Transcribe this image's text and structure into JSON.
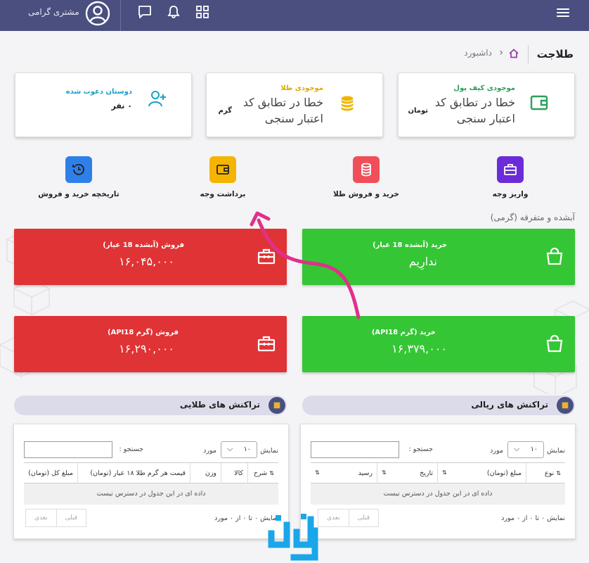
{
  "topbar": {
    "user_name": "مشتری گرامی",
    "icons": [
      "menu-icon",
      "grid-icon",
      "bell-icon",
      "chat-icon",
      "user-avatar-icon"
    ]
  },
  "breadcrumb": {
    "brand": "طلاجت",
    "current": "داشبورد"
  },
  "cards": {
    "wallet": {
      "title": "موجودی کیف پول",
      "value": "خطا در تطابق کد اعتبار سنجی",
      "unit": "تومان",
      "color": "#2e9e59"
    },
    "gold": {
      "title": "موجودی طلا",
      "value": "خطا در تطابق کد اعتبار سنجی",
      "unit": "گرم",
      "color": "#e0a800"
    },
    "friends": {
      "title": "دوستان دعوت شده",
      "value": "۰ نفر",
      "color": "#17a2c7"
    }
  },
  "actions": [
    {
      "label": "واریز وجه",
      "color": "#6b2bd9"
    },
    {
      "label": "خرید و فروش طلا",
      "color": "#f04e58"
    },
    {
      "label": "برداشت وجه",
      "color": "#f5b400"
    },
    {
      "label": "تاریخچه خرید و فروش",
      "color": "#2f7fe8"
    }
  ],
  "section_label": "آبشده و متفرقه (گرمی)",
  "tiles": {
    "buy_melted": {
      "title": "خرید (آبشده 18 عیار)",
      "value": "ندارِیم"
    },
    "sell_melted": {
      "title": "فروش (آبشده 18 عیار)",
      "value": "۱۶,۰۴۵,۰۰۰"
    },
    "buy_api": {
      "title": "خرید (گرم API18)",
      "value": "۱۶,۳۷۹,۰۰۰"
    },
    "sell_api": {
      "title": "فروش (گرم API18)",
      "value": "۱۶,۲۹۰,۰۰۰"
    }
  },
  "rial_tx": {
    "title": "تراکنش های ریالی",
    "show_label": "نمایش",
    "items_label": "مورد",
    "page_size": "۱۰",
    "search_label": "جستجو :",
    "columns": [
      "نوع",
      "مبلغ (تومان)",
      "تاریخ",
      "رسید"
    ],
    "empty": "داده ای در این جدول در دسترس نیست",
    "info": "نمایش ۰ تا ۰ از ۰ مورد",
    "prev": "قبلی",
    "next": "بعدی"
  },
  "gold_tx": {
    "title": "تراکنش های طلایی",
    "show_label": "نمایش",
    "items_label": "مورد",
    "page_size": "۱۰",
    "search_label": "جستجو :",
    "columns": [
      "شرح",
      "کالا",
      "وزن",
      "قیمت هر گرم طلا ۱۸ عیار (تومان)",
      "مبلغ کل (تومان)"
    ],
    "empty": "داده ای در این جدول در دسترس نیست",
    "info": "نمایش ۰ تا ۰ از ۰ مورد",
    "prev": "قبلی",
    "next": "بعدی"
  }
}
